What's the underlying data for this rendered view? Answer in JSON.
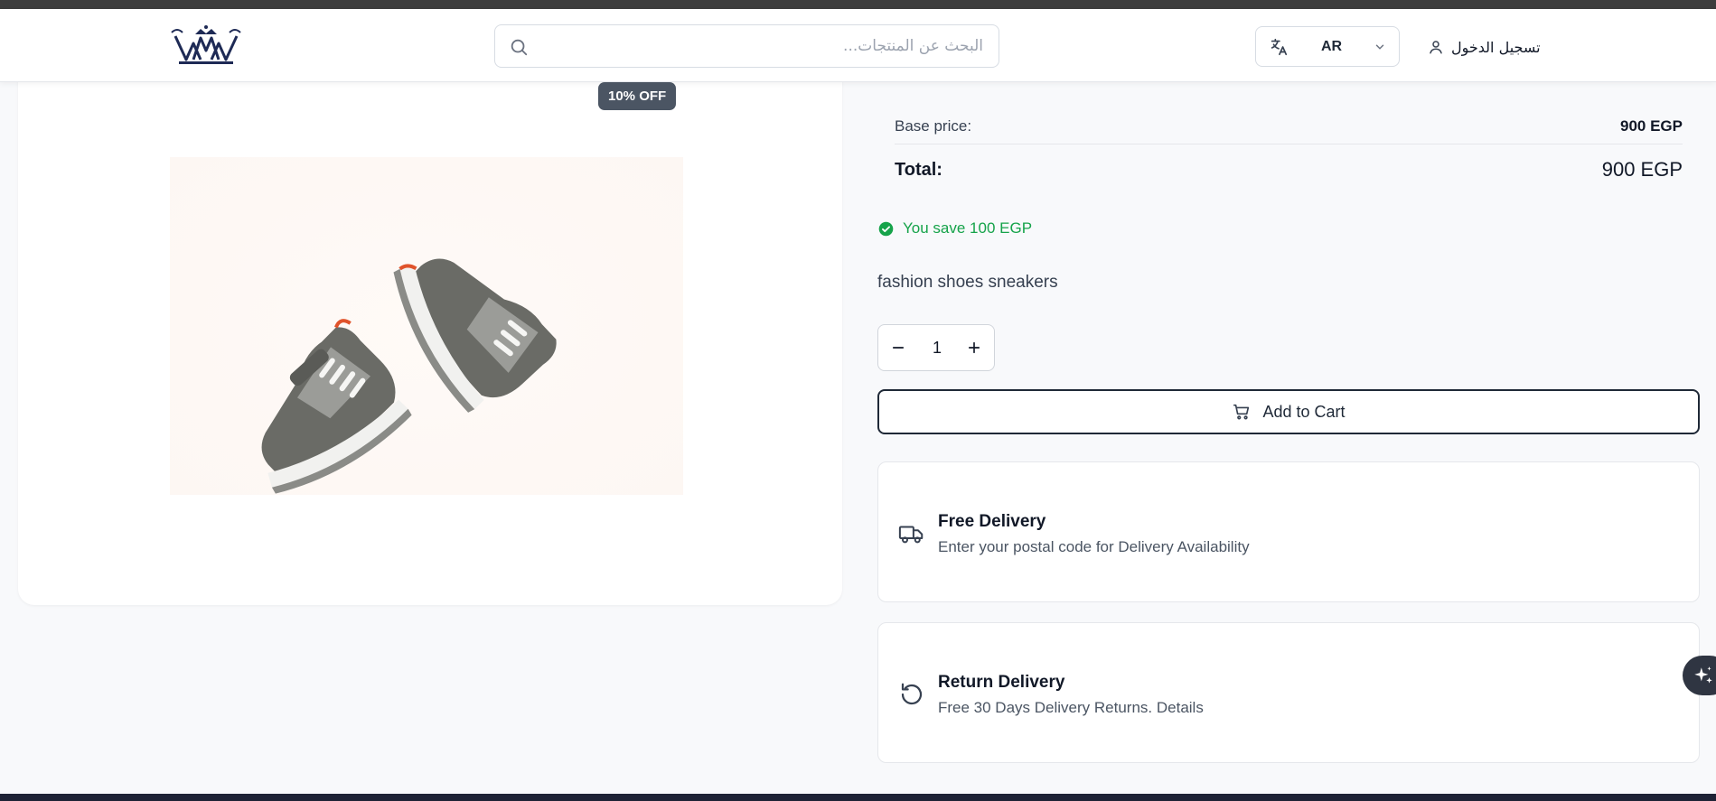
{
  "header": {
    "search_placeholder": "البحث عن المنتجات...",
    "language_code": "AR",
    "login_label": "تسجيل الدخول"
  },
  "product": {
    "discount_badge": "10% OFF",
    "base_price_label": "Base price:",
    "base_price_value": "900 EGP",
    "total_label": "Total:",
    "total_value": "900 EGP",
    "savings_text": "You save 100 EGP",
    "description": "fashion shoes sneakers",
    "quantity": "1",
    "add_to_cart_label": "Add to Cart"
  },
  "info_cards": {
    "delivery_title": "Free Delivery",
    "delivery_subtitle": "Enter your postal code for Delivery Availability",
    "return_title": "Return Delivery",
    "return_subtitle": "Free 30 Days Delivery Returns. Details"
  },
  "icons": {
    "search": "search-icon",
    "translate": "translate-icon",
    "chevron": "chevron-down-icon",
    "user": "user-icon",
    "check": "check-circle-icon",
    "minus": "minus-icon",
    "plus": "plus-icon",
    "cart": "cart-icon",
    "truck": "truck-icon",
    "rotate": "rotate-ccw-icon",
    "sparkles": "sparkles-icon"
  },
  "colors": {
    "accent_dark": "#1f2937",
    "badge_bg": "#4b5563",
    "success": "#16a34a",
    "logo_navy": "#1e2a55"
  }
}
